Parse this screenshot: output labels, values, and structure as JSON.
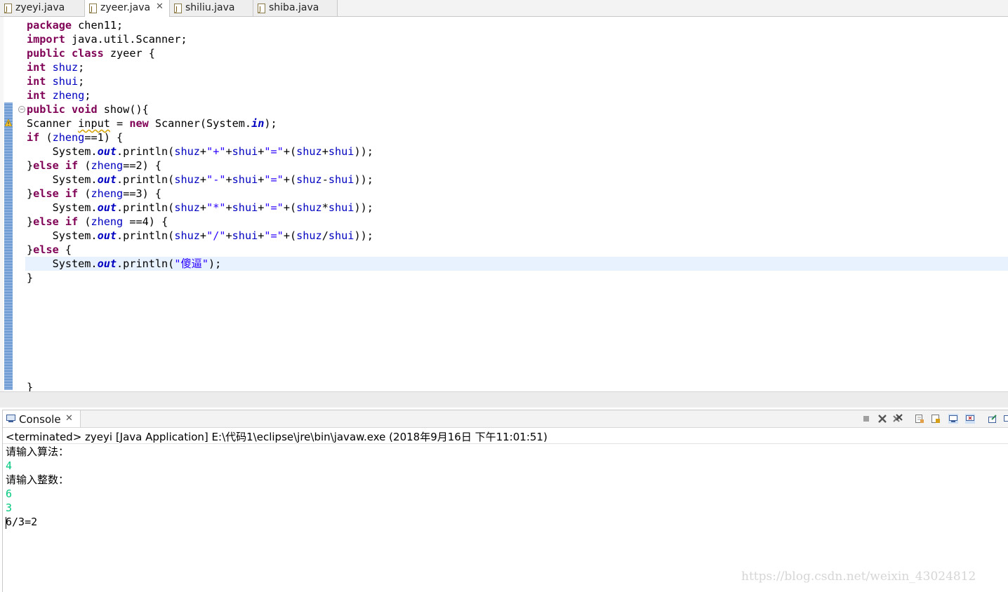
{
  "editor": {
    "tabs": [
      {
        "label": "zyeyi.java",
        "active": false,
        "closable": false
      },
      {
        "label": "zyeer.java",
        "active": true,
        "closable": true
      },
      {
        "label": "shiliu.java",
        "active": false,
        "closable": false
      },
      {
        "label": "shiba.java",
        "active": false,
        "closable": false
      }
    ],
    "tab_icon": "java-file-icon",
    "close_glyph": "✕",
    "code": {
      "l1_kw": "package",
      "l1_rest": " chen11;",
      "l2_kw": "import",
      "l2_rest": " java.util.Scanner;",
      "l3_kw1": "public",
      "l3_kw2": "class",
      "l3_rest": " zyeer {",
      "l4_kw": "int",
      "l4_field": "shuz",
      "l4_end": ";",
      "l5_kw": "int",
      "l5_field": "shui",
      "l5_end": ";",
      "l6_kw": "int",
      "l6_field": "zheng",
      "l6_end": ";",
      "l7_kw1": "public",
      "l7_kw2": "void",
      "l7_rest": " show(){",
      "l8_a": "Scanner ",
      "l8_var": "input",
      "l8_b": " = ",
      "l8_kw": "new",
      "l8_c": " Scanner(System.",
      "l8_st": "in",
      "l8_d": ");",
      "l9_kw": "if",
      "l9_a": " (",
      "l9_fld": "zheng",
      "l9_b": "==1) {",
      "l10_a": "    System.",
      "l10_st": "out",
      "l10_b": ".println(",
      "l10_f1": "shuz",
      "l10_c": "+",
      "l10_s1": "\"+\"",
      "l10_d": "+",
      "l10_f2": "shui",
      "l10_e": "+",
      "l10_s2": "\"=\"",
      "l10_g": "+(",
      "l10_f3": "shuz",
      "l10_h": "+",
      "l10_f4": "shui",
      "l10_i": "));",
      "l11_a": "}",
      "l11_kw1": "else",
      "l11_b": " ",
      "l11_kw2": "if",
      "l11_c": " (",
      "l11_fld": "zheng",
      "l11_d": "==2) {",
      "l12_a": "    System.",
      "l12_st": "out",
      "l12_b": ".println(",
      "l12_f1": "shuz",
      "l12_c": "+",
      "l12_s1": "\"-\"",
      "l12_d": "+",
      "l12_f2": "shui",
      "l12_e": "+",
      "l12_s2": "\"=\"",
      "l12_g": "+(",
      "l12_f3": "shuz",
      "l12_h": "-",
      "l12_f4": "shui",
      "l12_i": "));",
      "l13_a": "}",
      "l13_kw1": "else",
      "l13_b": " ",
      "l13_kw2": "if",
      "l13_c": " (",
      "l13_fld": "zheng",
      "l13_d": "==3) {",
      "l14_a": "    System.",
      "l14_st": "out",
      "l14_b": ".println(",
      "l14_f1": "shuz",
      "l14_c": "+",
      "l14_s1": "\"*\"",
      "l14_d": "+",
      "l14_f2": "shui",
      "l14_e": "+",
      "l14_s2": "\"=\"",
      "l14_g": "+(",
      "l14_f3": "shuz",
      "l14_h": "*",
      "l14_f4": "shui",
      "l14_i": "));",
      "l15_a": "}",
      "l15_kw1": "else",
      "l15_b": " ",
      "l15_kw2": "if",
      "l15_c": " (",
      "l15_fld": "zheng",
      "l15_d": " ==4) {",
      "l16_a": "    System.",
      "l16_st": "out",
      "l16_b": ".println(",
      "l16_f1": "shuz",
      "l16_c": "+",
      "l16_s1": "\"/\"",
      "l16_d": "+",
      "l16_f2": "shui",
      "l16_e": "+",
      "l16_s2": "\"=\"",
      "l16_g": "+(",
      "l16_f3": "shuz",
      "l16_h": "/",
      "l16_f4": "shui",
      "l16_i": "));",
      "l17_a": "}",
      "l17_kw": "else",
      "l17_b": " {",
      "l18_a": "    System.",
      "l18_st": "out",
      "l18_b": ".println(",
      "l18_s": "\"傻逼\"",
      "l18_c": ");",
      "l19": "}",
      "l20": "}"
    }
  },
  "console": {
    "tab_label": "Console",
    "close_glyph": "✕",
    "description": "<terminated> zyeyi [Java Application] E:\\代码1\\eclipse\\jre\\bin\\javaw.exe (2018年9月16日 下午11:01:51)",
    "output": [
      {
        "text": "请输入算法：",
        "kind": "normal"
      },
      {
        "text": "4",
        "kind": "input"
      },
      {
        "text": "请输入整数：",
        "kind": "normal"
      },
      {
        "text": "6",
        "kind": "input"
      },
      {
        "text": "3",
        "kind": "input"
      },
      {
        "text": "6/3=2",
        "kind": "result"
      }
    ],
    "toolbar_icons": [
      "terminate-icon",
      "remove-launch-icon",
      "remove-all-launches-icon",
      "clear-console-icon",
      "scroll-lock-icon",
      "show-on-stdout-icon",
      "show-on-stderr-icon",
      "pin-console-icon",
      "display-console-icon"
    ]
  },
  "watermark": "https://blog.csdn.net/weixin_43024812",
  "colors": {
    "keyword": "#7f0055",
    "field": "#0000c0",
    "string": "#2a00ff",
    "console_input": "#00c87d",
    "current_line": "#e8f2fe"
  }
}
